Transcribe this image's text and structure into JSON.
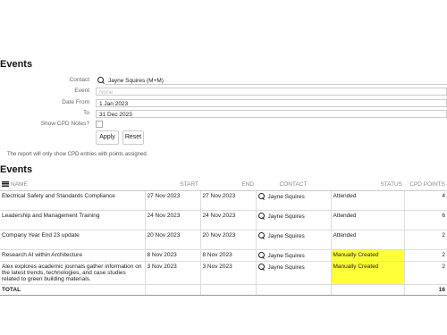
{
  "page_title": "Events",
  "form": {
    "contact_label": "Contact",
    "contact_value": "Jayne Squires (M+M)",
    "event_label": "Event",
    "event_placeholder": "None",
    "date_from_label": "Date From",
    "date_from_value": "1 Jan 2023",
    "to_label": "To",
    "to_value": "31 Dec 2023",
    "show_cpd_label": "Show CPD Notes?",
    "apply_label": "Apply",
    "reset_label": "Reset",
    "note": "The report will only show CPD entries with points assigned."
  },
  "events_heading": "Events",
  "table": {
    "columns": [
      "NAME",
      "START",
      "END",
      "CONTACT",
      "STATUS",
      "CPD POINTS"
    ],
    "rows": [
      {
        "name": "Electrical Safety and Standards Compliance",
        "start": "27 Nov 2023",
        "end": "27 Nov 2023",
        "contact": "Jayne Squires",
        "status": "Attended",
        "points": "4",
        "highlight": false
      },
      {
        "name": "Leadership and Management Training",
        "start": "24 Nov 2023",
        "end": "24 Nov 2023",
        "contact": "Jayne Squires",
        "status": "Attended",
        "points": "6",
        "highlight": false
      },
      {
        "name": "Company Year End 23 update",
        "start": "20 Nov 2023",
        "end": "20 Nov 2023",
        "contact": "Jayne Squires",
        "status": "Attended",
        "points": "2",
        "highlight": false
      },
      {
        "name": "Research AI within Architecture",
        "start": "8 Nov 2023",
        "end": "8 Nov 2023",
        "contact": "Jayne Squires",
        "status": "Manually Created",
        "points": "2",
        "highlight": true
      },
      {
        "name": "Alex explores academic journals gather information on the latest trends, technologies, and case studies related to green building materials.",
        "start": "3 Nov 2023",
        "end": "3 Nov 2023",
        "contact": "Jayne Squires",
        "status": "Manually Created",
        "points": "2",
        "highlight": true
      }
    ],
    "total_label": "TOTAL",
    "total_points": "16"
  },
  "colors": {
    "highlight": "#ffff3a"
  }
}
